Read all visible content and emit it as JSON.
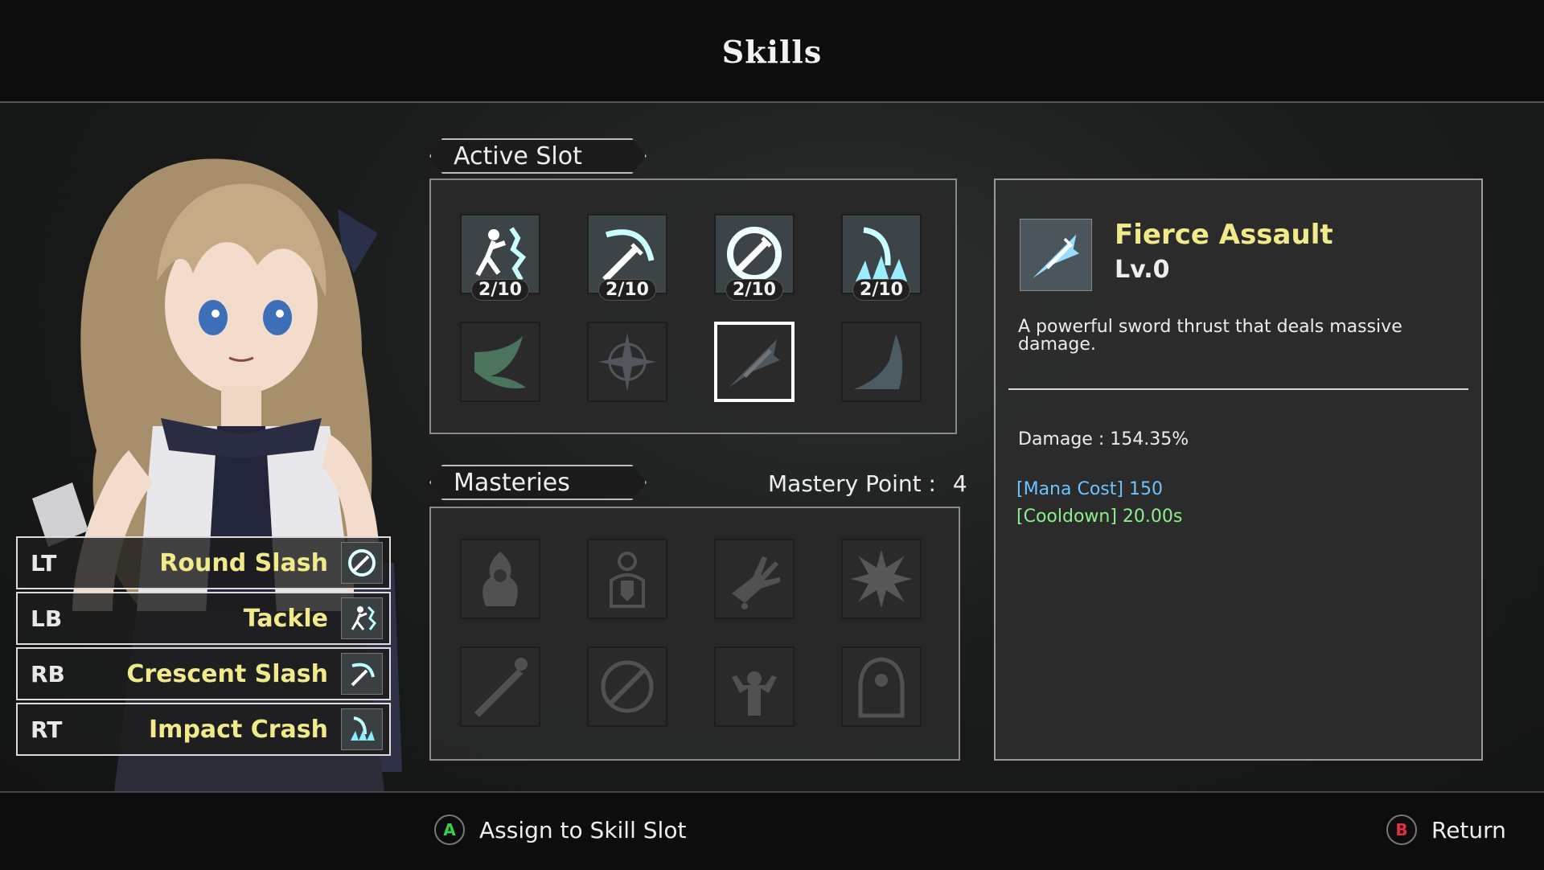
{
  "header": {
    "title": "Skills"
  },
  "bindings": [
    {
      "key": "LT",
      "skill": "Round Slash",
      "icon": "round-slash-icon"
    },
    {
      "key": "LB",
      "skill": "Tackle",
      "icon": "tackle-icon"
    },
    {
      "key": "RB",
      "skill": "Crescent Slash",
      "icon": "crescent-slash-icon"
    },
    {
      "key": "RT",
      "skill": "Impact Crash",
      "icon": "impact-crash-icon"
    }
  ],
  "active_slot": {
    "label": "Active Slot",
    "skills": [
      {
        "icon": "tackle-icon",
        "level": "2/10"
      },
      {
        "icon": "crescent-slash-icon",
        "level": "2/10"
      },
      {
        "icon": "round-slash-icon",
        "level": "2/10"
      },
      {
        "icon": "impact-crash-icon",
        "level": "2/10"
      },
      {
        "icon": "swoosh-icon"
      },
      {
        "icon": "star-burst-icon"
      },
      {
        "icon": "fierce-assault-icon"
      },
      {
        "icon": "claw-wave-icon"
      }
    ]
  },
  "masteries": {
    "label": "Masteries",
    "point_label": "Mastery Point :",
    "point_value": "4",
    "icons": [
      "fire-body-icon",
      "shield-body-icon",
      "bleeding-arm-icon",
      "explosion-icon",
      "sword-strike-icon",
      "no-sword-icon",
      "power-pose-icon",
      "cape-icon"
    ]
  },
  "detail": {
    "name": "Fierce Assault",
    "level": "Lv.0",
    "description": "A powerful sword thrust that deals massive damage.",
    "damage": "Damage : 154.35%",
    "mana": "[Mana Cost] 150",
    "cooldown": "[Cooldown] 20.00s"
  },
  "footer": {
    "assign_button": "A",
    "assign_label": "Assign to Skill Slot",
    "return_button": "B",
    "return_label": "Return"
  },
  "colors": {
    "skill_name": "#f0ea8a",
    "mana": "#6cc4ff",
    "cooldown": "#8cf08c",
    "a_button": "#35d04a",
    "b_button": "#e03040"
  }
}
